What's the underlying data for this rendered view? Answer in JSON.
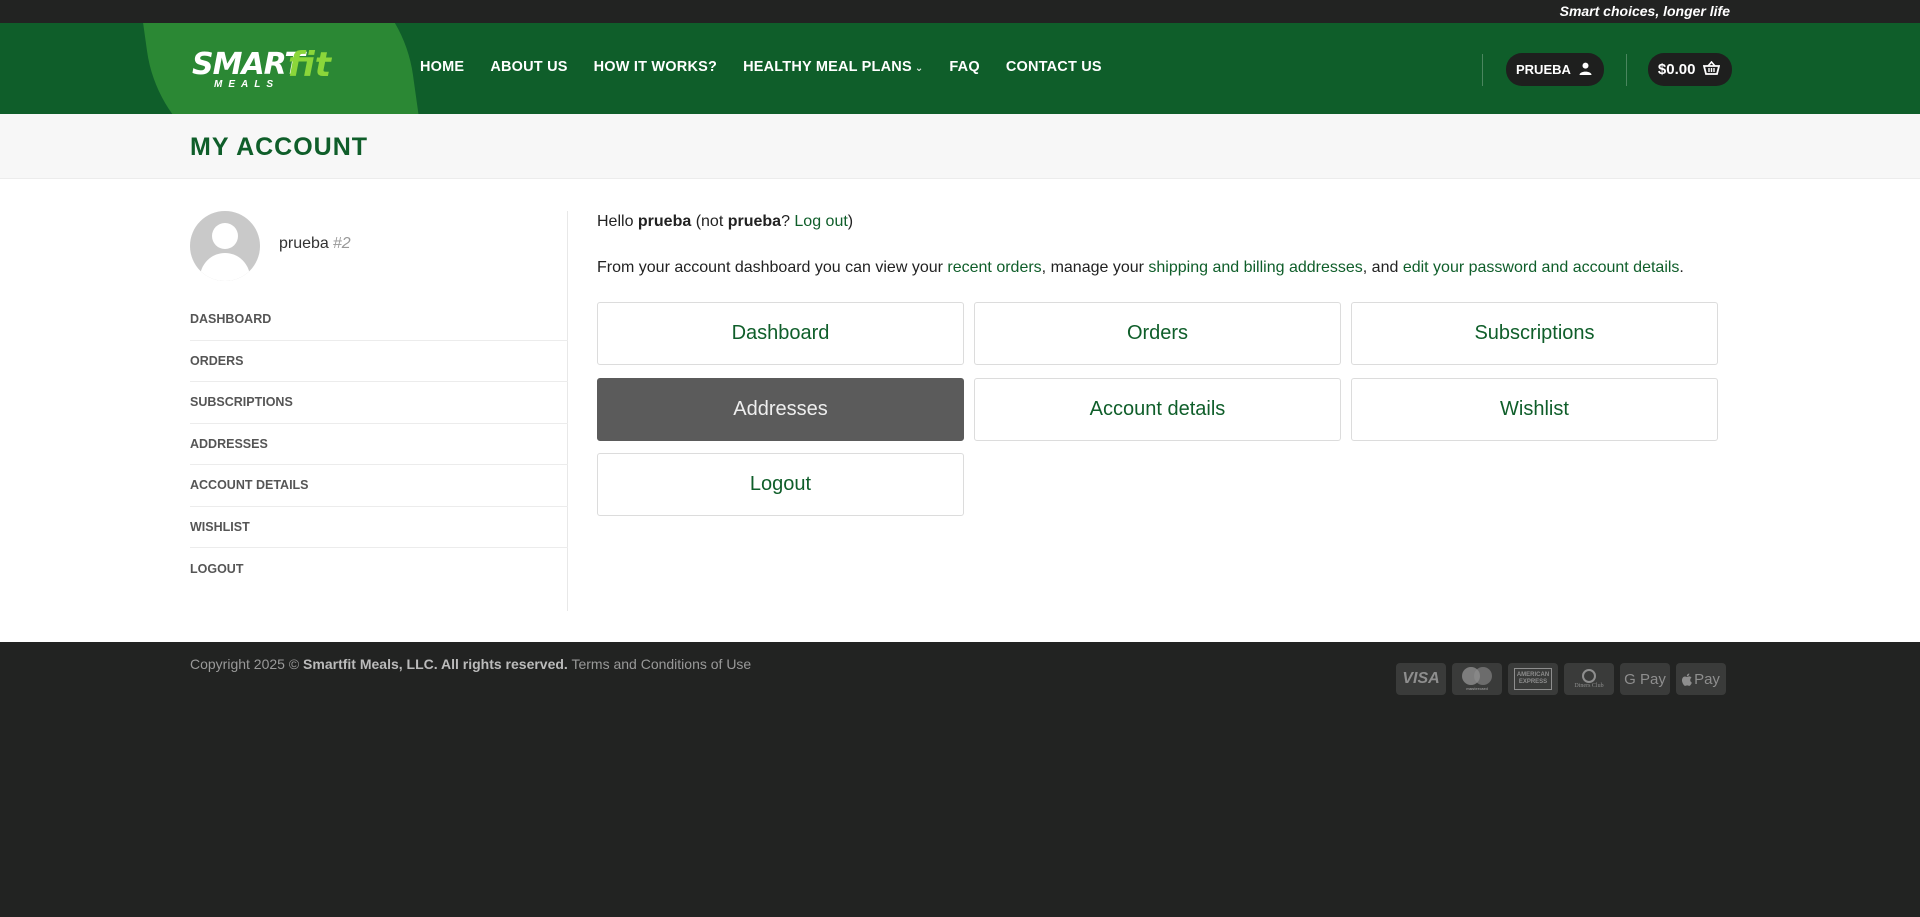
{
  "topbar": {
    "tagline": "Smart choices, longer life"
  },
  "logo": {
    "word": "SMART",
    "sub": "MEALS",
    "mark": "fit"
  },
  "nav": {
    "items": [
      "HOME",
      "ABOUT US",
      "HOW IT WORKS?",
      "HEALTHY MEAL PLANS",
      "FAQ",
      "CONTACT US"
    ],
    "dropdown_icon": "chevron-down-icon"
  },
  "header_right": {
    "account_label": "PRUEBA",
    "account_icon": "user-icon",
    "cart_total": "$0.00",
    "cart_icon": "basket-icon"
  },
  "page_title": "MY ACCOUNT",
  "sidebar": {
    "username": "prueba",
    "user_id": "#2",
    "items": [
      "DASHBOARD",
      "ORDERS",
      "SUBSCRIPTIONS",
      "ADDRESSES",
      "ACCOUNT DETAILS",
      "WISHLIST",
      "LOGOUT"
    ]
  },
  "content": {
    "hello": {
      "prefix": "Hello ",
      "user": "prueba",
      "mid": " (not ",
      "user2": "prueba",
      "q": "? ",
      "logout_link": "Log out",
      "end": ")"
    },
    "intro": {
      "prefix": "From your account dashboard you can view your ",
      "link1": "recent orders",
      "mid1": ", manage your ",
      "link2": "shipping and billing addresses",
      "mid2": ", and ",
      "link3": "edit your password and account details",
      "end": "."
    },
    "buttons": [
      "Dashboard",
      "Orders",
      "Subscriptions",
      "Addresses",
      "Account details",
      "Wishlist",
      "Logout"
    ],
    "active_button": "Addresses"
  },
  "footer": {
    "copyright_prefix": "Copyright 2025 © ",
    "company": "Smartfit Meals, LLC. All rights reserved.",
    "terms": "Terms and Conditions of Use",
    "payments": [
      "VISA",
      "mastercard",
      "AMERICAN EXPRESS",
      "Diners Club",
      "G Pay",
      "Pay"
    ]
  },
  "colors": {
    "brand_green": "#0f5e2a",
    "leaf_green": "#2f8d35",
    "accent_lime": "#8bd63a",
    "dark": "#222322",
    "active_button": "#5b5b5b"
  }
}
